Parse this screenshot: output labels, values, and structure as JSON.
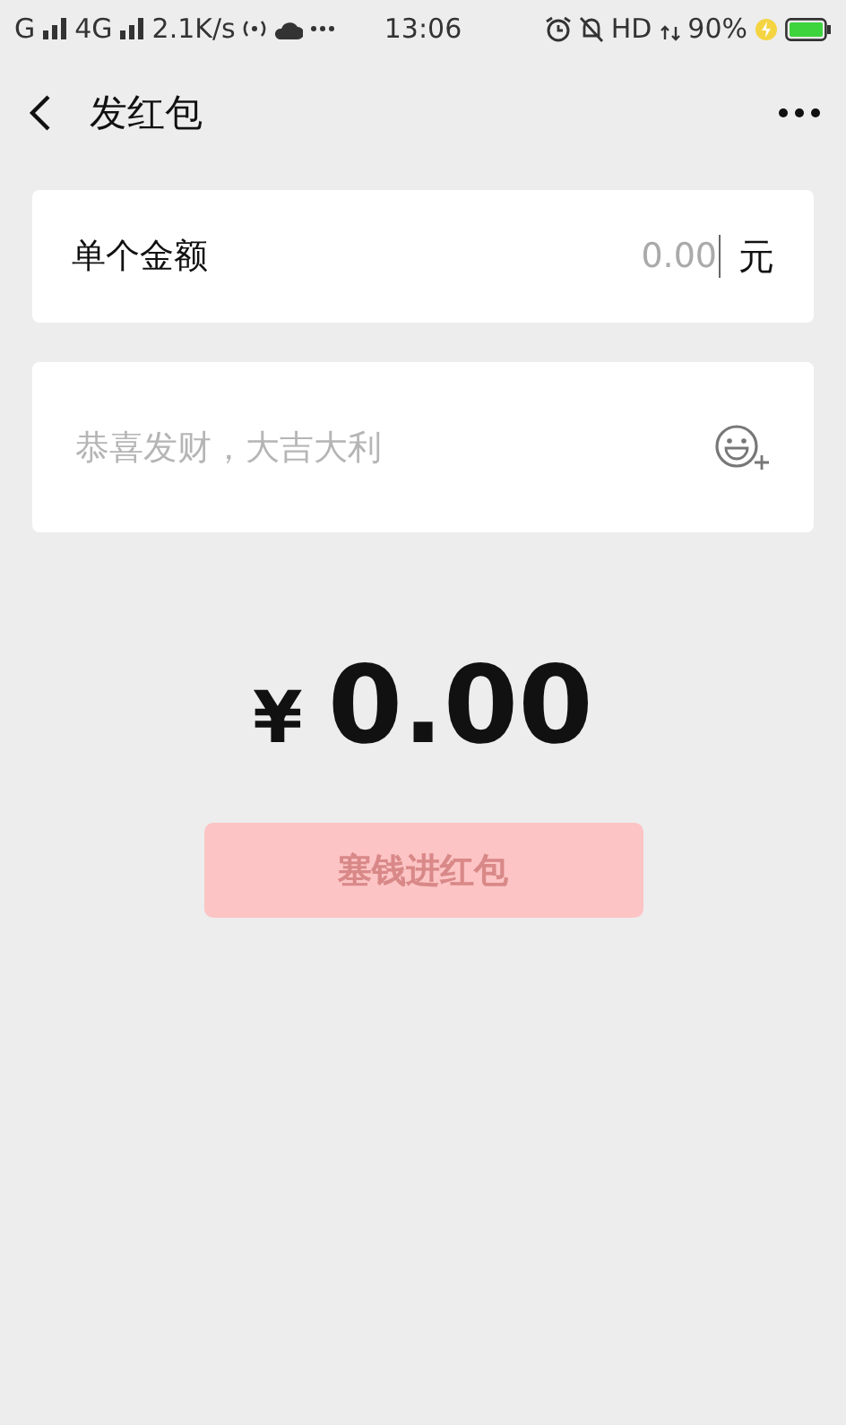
{
  "status_bar": {
    "carrier1": "G",
    "carrier2": "4G",
    "speed": "2.1K/s",
    "time": "13:06",
    "hd": "HD",
    "battery": "90%"
  },
  "nav": {
    "title": "发红包"
  },
  "amount_field": {
    "label": "单个金额",
    "placeholder": "0.00",
    "unit": "元"
  },
  "greeting_field": {
    "placeholder": "恭喜发财，大吉大利"
  },
  "total": {
    "currency": "¥",
    "amount": "0.00"
  },
  "submit": {
    "label": "塞钱进红包",
    "disabled": true
  }
}
